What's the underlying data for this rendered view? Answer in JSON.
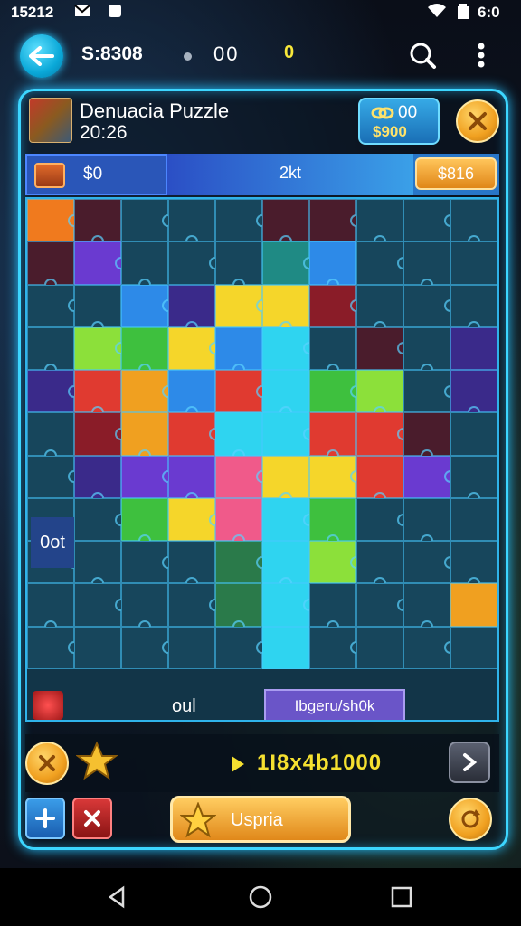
{
  "status_bar": {
    "time": "15212",
    "right_time": "6:0"
  },
  "top_bar": {
    "coins": "S:8308",
    "score": "00",
    "yellow_value": "0"
  },
  "header": {
    "title": "Denuacia Puzzle",
    "timer": "20:26",
    "coin_top": "00",
    "coin_bottom": "$900"
  },
  "info_row": {
    "left_amount": "$0",
    "middle_text": "2kt",
    "right_button": "$816"
  },
  "board": {
    "columns": 10,
    "rows": 11,
    "side_label": "0ot",
    "foot_text": "oul",
    "foot_pill": "Ibgeru/sh0k",
    "colors": {
      "default": "#17465c",
      "orange": "#f07a1e",
      "maroon": "#4a1c2c",
      "yellow": "#f5d62a",
      "green": "#3ec03e",
      "blue": "#2d8ae8",
      "red": "#e03a30",
      "cyan": "#2fd4f0",
      "lime": "#8ce03a",
      "purple": "#6a3ad0",
      "pink": "#f05a8a",
      "darkred": "#8a1c28",
      "teal": "#1f8a84",
      "amber": "#f0a020",
      "darkgreen": "#2a7a4a",
      "violet": "#3a2a8a"
    },
    "grid": [
      [
        "orange",
        "maroon",
        "default",
        "default",
        "default",
        "maroon",
        "maroon",
        "default",
        "default",
        "default"
      ],
      [
        "maroon",
        "purple",
        "default",
        "default",
        "default",
        "teal",
        "blue",
        "default",
        "default",
        "default"
      ],
      [
        "default",
        "default",
        "blue",
        "violet",
        "yellow",
        "yellow",
        "darkred",
        "default",
        "default",
        "default"
      ],
      [
        "default",
        "lime",
        "green",
        "yellow",
        "blue",
        "cyan",
        "default",
        "maroon",
        "default",
        "violet"
      ],
      [
        "violet",
        "red",
        "amber",
        "blue",
        "red",
        "cyan",
        "green",
        "lime",
        "default",
        "violet"
      ],
      [
        "default",
        "darkred",
        "amber",
        "red",
        "cyan",
        "cyan",
        "red",
        "red",
        "maroon",
        "default"
      ],
      [
        "default",
        "violet",
        "purple",
        "purple",
        "pink",
        "yellow",
        "yellow",
        "red",
        "purple",
        "default"
      ],
      [
        "default",
        "default",
        "green",
        "yellow",
        "pink",
        "cyan",
        "green",
        "default",
        "default",
        "default"
      ],
      [
        "default",
        "default",
        "default",
        "default",
        "darkgreen",
        "cyan",
        "lime",
        "default",
        "default",
        "default"
      ],
      [
        "default",
        "default",
        "default",
        "default",
        "darkgreen",
        "cyan",
        "default",
        "default",
        "default",
        "amber"
      ],
      [
        "default",
        "default",
        "default",
        "default",
        "default",
        "cyan",
        "default",
        "default",
        "default",
        "default"
      ]
    ]
  },
  "action_row": {
    "score": "1I8x4b1000"
  },
  "bottom_row": {
    "main_button": "Uspria"
  }
}
